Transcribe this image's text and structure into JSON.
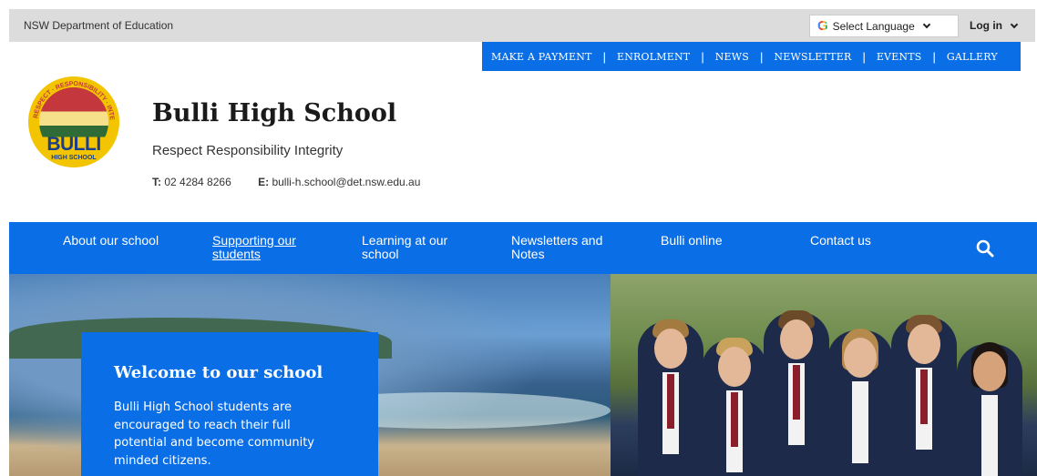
{
  "utility": {
    "department": "NSW Department of Education",
    "language_label": "Select Language",
    "login_label": "Log in"
  },
  "quick_links": [
    "MAKE A PAYMENT",
    "ENROLMENT",
    "NEWS",
    "NEWSLETTER",
    "EVENTS",
    "GALLERY"
  ],
  "logo": {
    "name": "BULLI",
    "sub": "HIGH SCHOOL",
    "ring_text": "RESPECT · RESPONSIBILITY · INTEGRITY"
  },
  "school": {
    "title": "Bulli High School",
    "motto": "Respect Responsibility Integrity",
    "phone_label": "T:",
    "phone": "02 4284 8266",
    "email_label": "E:",
    "email": "bulli-h.school@det.nsw.edu.au"
  },
  "nav": {
    "items": [
      "About our school",
      "Supporting our students",
      "Learning at our school",
      "Newsletters and Notes",
      "Bulli online",
      "Contact us"
    ],
    "active_index": 1
  },
  "hero": {
    "welcome_title": "Welcome to our school",
    "welcome_text": "Bulli High School students are encouraged to reach their full potential and become community minded citizens."
  },
  "colors": {
    "brand_blue": "#0a6ee6",
    "utility_gray": "#dcdcdc"
  }
}
